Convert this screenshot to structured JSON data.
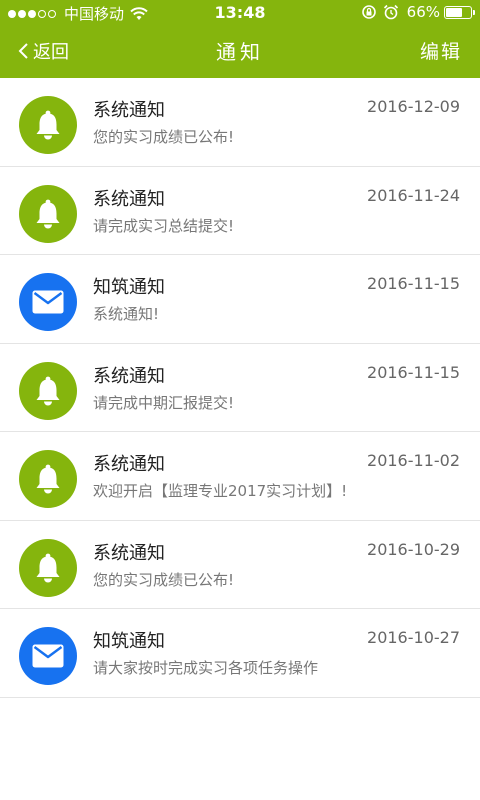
{
  "status": {
    "carrier": "中国移动",
    "time": "13:48",
    "battery": "66%",
    "battery_level": 0.66,
    "signal_bars": 3,
    "icons": [
      "wifi-icon",
      "rotation-lock-icon",
      "alarm-icon",
      "battery-icon"
    ]
  },
  "nav": {
    "back_label": "返回",
    "title": "通知",
    "edit_label": "编辑"
  },
  "colors": {
    "accent": "#85b50d",
    "mail": "#1772f0"
  },
  "notifications": [
    {
      "icon": "bell-icon",
      "title": "系统通知",
      "date": "2016-12-09",
      "message": "您的实习成绩已公布!"
    },
    {
      "icon": "bell-icon",
      "title": "系统通知",
      "date": "2016-11-24",
      "message": "请完成实习总结提交!"
    },
    {
      "icon": "mail-icon",
      "title": "知筑通知",
      "date": "2016-11-15",
      "message": "系统通知!"
    },
    {
      "icon": "bell-icon",
      "title": "系统通知",
      "date": "2016-11-15",
      "message": "请完成中期汇报提交!"
    },
    {
      "icon": "bell-icon",
      "title": "系统通知",
      "date": "2016-11-02",
      "message": "欢迎开启【监理专业2017实习计划】!"
    },
    {
      "icon": "bell-icon",
      "title": "系统通知",
      "date": "2016-10-29",
      "message": "您的实习成绩已公布!"
    },
    {
      "icon": "mail-icon",
      "title": "知筑通知",
      "date": "2016-10-27",
      "message": "请大家按时完成实习各项任务操作"
    }
  ]
}
